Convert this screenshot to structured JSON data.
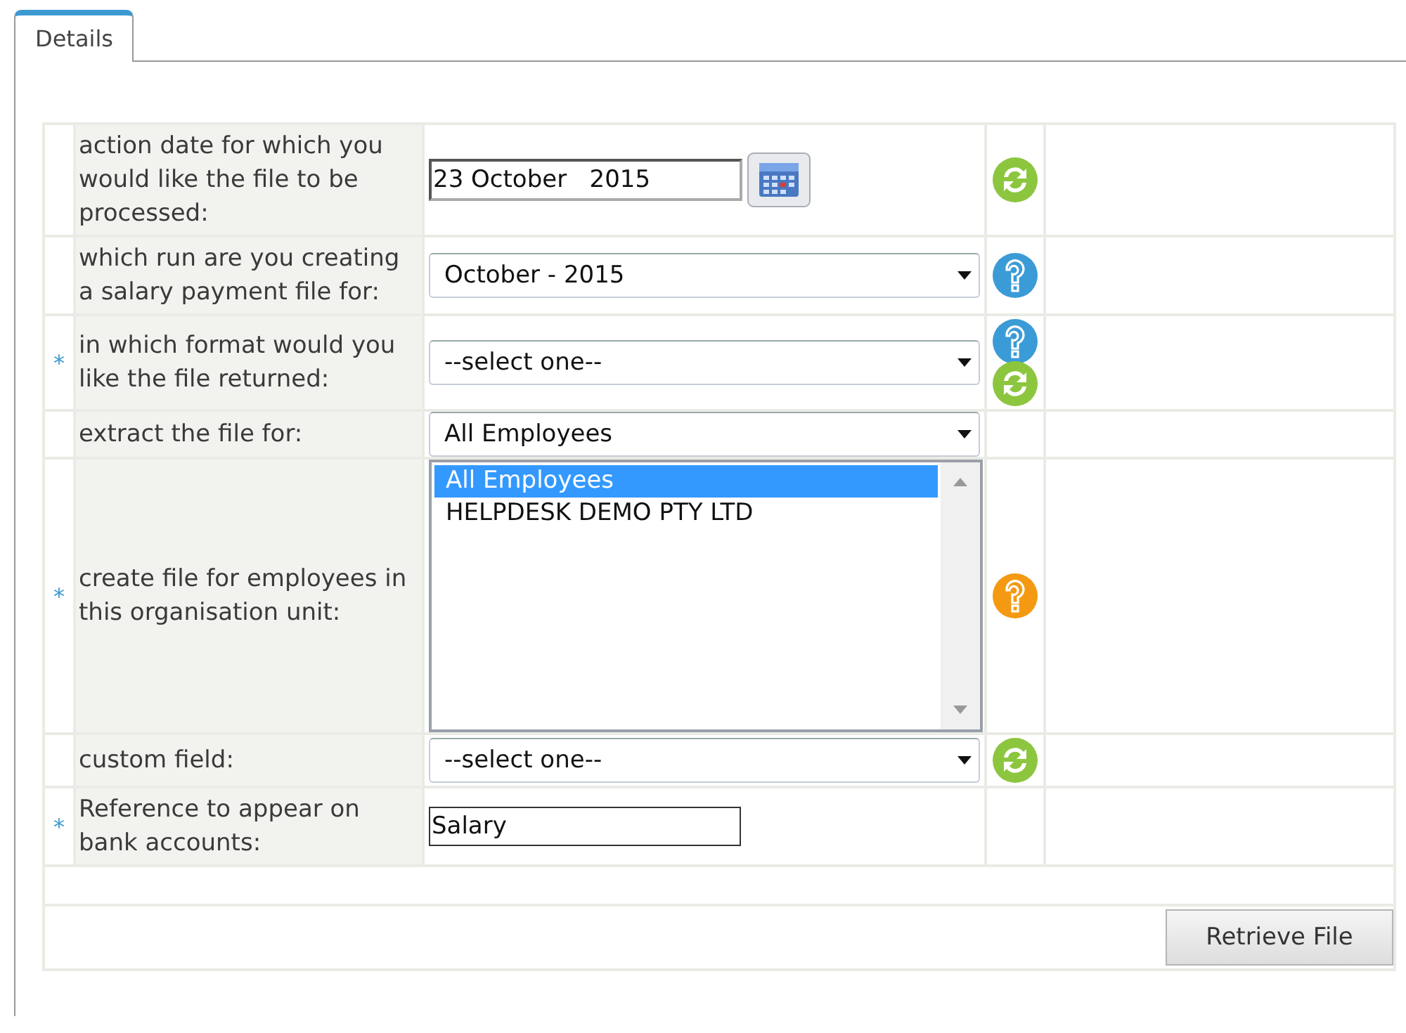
{
  "tabs": [
    {
      "label": "Details",
      "selected": true
    }
  ],
  "rows": [
    {
      "kind": "date",
      "required": false,
      "label": "action date for which you would like the file to be processed:",
      "value": "23 October   2015",
      "icons": [
        {
          "kind": "refresh",
          "color": "#8cc63f"
        }
      ]
    },
    {
      "kind": "select",
      "required": false,
      "label": "which run are you creating a salary payment file for:",
      "value": "October - 2015",
      "icons": [
        {
          "kind": "help",
          "color": "#3b9bd6"
        }
      ]
    },
    {
      "kind": "select",
      "required": true,
      "label": "in which format would you like the file returned:",
      "value": "--select one--",
      "icons": [
        {
          "kind": "help",
          "color": "#3b9bd6"
        },
        {
          "kind": "refresh",
          "color": "#8cc63f"
        }
      ]
    },
    {
      "kind": "select",
      "required": false,
      "label": "extract the file for:",
      "value": "All Employees",
      "icons": []
    },
    {
      "kind": "listbox",
      "required": true,
      "label": "create file for employees in this organisation unit:",
      "options": [
        {
          "label": "All Employees",
          "selected": true
        },
        {
          "label": "HELPDESK DEMO PTY LTD",
          "selected": false
        }
      ],
      "icons": [
        {
          "kind": "help",
          "color": "#f39a12"
        }
      ]
    },
    {
      "kind": "select",
      "required": false,
      "label": "custom field:",
      "value": "--select one--",
      "icons": [
        {
          "kind": "refresh",
          "color": "#8cc63f"
        }
      ]
    },
    {
      "kind": "text",
      "required": true,
      "label": "Reference to appear on bank accounts:",
      "value": "Salary",
      "icons": []
    }
  ],
  "required_mark": "*",
  "submit": "Retrieve File"
}
